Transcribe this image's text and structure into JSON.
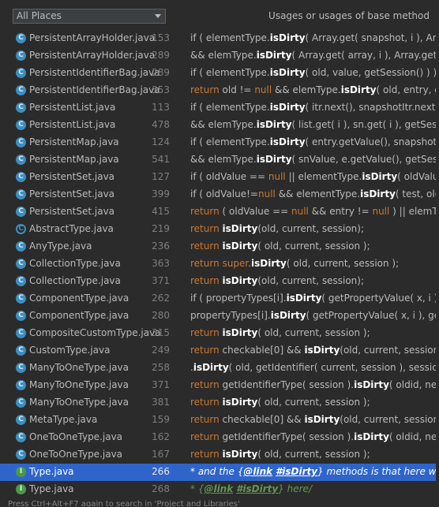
{
  "toolbar": {
    "scope_label": "All Places",
    "title": "Usages or usages of base method"
  },
  "usages": [
    {
      "icon": "class",
      "file": "PersistentArrayHolder.java",
      "line": "153",
      "code": [
        [
          "p",
          "if ( elementType."
        ],
        [
          "h",
          "isDirty"
        ],
        [
          "p",
          "( Array.get( snapshot, i ), Array.get"
        ]
      ]
    },
    {
      "icon": "class",
      "file": "PersistentArrayHolder.java",
      "line": "289",
      "code": [
        [
          "p",
          "&& elemType."
        ],
        [
          "h",
          "isDirty"
        ],
        [
          "p",
          "( Array.get( array, i ), Array.get( sn, i"
        ]
      ]
    },
    {
      "icon": "class",
      "file": "PersistentIdentifierBag.java",
      "line": "289",
      "code": [
        [
          "p",
          "if ( elementType."
        ],
        [
          "h",
          "isDirty"
        ],
        [
          "p",
          "( old, value, getSession() ) ) {"
        ]
      ]
    },
    {
      "icon": "class",
      "file": "PersistentIdentifierBag.java",
      "line": "353",
      "code": [
        [
          "k",
          "return"
        ],
        [
          "p",
          " old != "
        ],
        [
          "k",
          "null"
        ],
        [
          "p",
          " && elemType."
        ],
        [
          "h",
          "isDirty"
        ],
        [
          "p",
          "( old, entry, getSe"
        ]
      ]
    },
    {
      "icon": "class",
      "file": "PersistentList.java",
      "line": "113",
      "code": [
        [
          "p",
          "if ( elementType."
        ],
        [
          "h",
          "isDirty"
        ],
        [
          "p",
          "( itr.next(), snapshotItr.next(), getS"
        ]
      ]
    },
    {
      "icon": "class",
      "file": "PersistentList.java",
      "line": "478",
      "code": [
        [
          "p",
          "&& elemType."
        ],
        [
          "h",
          "isDirty"
        ],
        [
          "p",
          "( list.get( i ), sn.get( i ), getSession()"
        ]
      ]
    },
    {
      "icon": "class",
      "file": "PersistentMap.java",
      "line": "124",
      "code": [
        [
          "p",
          "if ( elementType."
        ],
        [
          "h",
          "isDirty"
        ],
        [
          "p",
          "( entry.getValue(), snapshotMap.g"
        ]
      ]
    },
    {
      "icon": "class",
      "file": "PersistentMap.java",
      "line": "541",
      "code": [
        [
          "p",
          "&& elemType."
        ],
        [
          "h",
          "isDirty"
        ],
        [
          "p",
          "( snValue, e.getValue(), getSession()"
        ]
      ]
    },
    {
      "icon": "class",
      "file": "PersistentSet.java",
      "line": "127",
      "code": [
        [
          "p",
          "if ( oldValue == "
        ],
        [
          "k",
          "null"
        ],
        [
          "p",
          " || elementType."
        ],
        [
          "h",
          "isDirty"
        ],
        [
          "p",
          "( oldValue, tes"
        ]
      ]
    },
    {
      "icon": "class",
      "file": "PersistentSet.java",
      "line": "399",
      "code": [
        [
          "p",
          "if ( oldValue!="
        ],
        [
          "k",
          "null"
        ],
        [
          "p",
          " && elementType."
        ],
        [
          "h",
          "isDirty"
        ],
        [
          "p",
          "( test, oldValu"
        ]
      ]
    },
    {
      "icon": "class",
      "file": "PersistentSet.java",
      "line": "415",
      "code": [
        [
          "k",
          "return"
        ],
        [
          "p",
          " ( oldValue == "
        ],
        [
          "k",
          "null"
        ],
        [
          "p",
          " && entry != "
        ],
        [
          "k",
          "null"
        ],
        [
          "p",
          " ) || elemType.i"
        ]
      ]
    },
    {
      "icon": "abstract",
      "file": "AbstractType.java",
      "line": "219",
      "code": [
        [
          "k",
          "return"
        ],
        [
          "p",
          " "
        ],
        [
          "h",
          "isDirty"
        ],
        [
          "p",
          "(old, current, session);"
        ]
      ]
    },
    {
      "icon": "class",
      "file": "AnyType.java",
      "line": "236",
      "code": [
        [
          "k",
          "return"
        ],
        [
          "p",
          " "
        ],
        [
          "h",
          "isDirty"
        ],
        [
          "p",
          "( old, current, session );"
        ]
      ]
    },
    {
      "icon": "class",
      "file": "CollectionType.java",
      "line": "363",
      "code": [
        [
          "k",
          "return super"
        ],
        [
          "p",
          "."
        ],
        [
          "h",
          "isDirty"
        ],
        [
          "p",
          "( old, current, session );"
        ]
      ]
    },
    {
      "icon": "class",
      "file": "CollectionType.java",
      "line": "371",
      "code": [
        [
          "k",
          "return"
        ],
        [
          "p",
          " "
        ],
        [
          "h",
          "isDirty"
        ],
        [
          "p",
          "(old, current, session);"
        ]
      ]
    },
    {
      "icon": "class",
      "file": "ComponentType.java",
      "line": "262",
      "code": [
        [
          "p",
          "if ( propertyTypes[i]."
        ],
        [
          "h",
          "isDirty"
        ],
        [
          "p",
          "( getPropertyValue( x, i ), getPr"
        ]
      ]
    },
    {
      "icon": "class",
      "file": "ComponentType.java",
      "line": "280",
      "code": [
        [
          "p",
          "propertyTypes[i]."
        ],
        [
          "h",
          "isDirty"
        ],
        [
          "p",
          "( getPropertyValue( x, i ), getPrope"
        ]
      ]
    },
    {
      "icon": "class",
      "file": "CompositeCustomType.java",
      "line": "315",
      "code": [
        [
          "k",
          "return"
        ],
        [
          "p",
          " "
        ],
        [
          "h",
          "isDirty"
        ],
        [
          "p",
          "( old, current, session );"
        ]
      ]
    },
    {
      "icon": "class",
      "file": "CustomType.java",
      "line": "249",
      "code": [
        [
          "k",
          "return"
        ],
        [
          "p",
          " checkable[0] && "
        ],
        [
          "h",
          "isDirty"
        ],
        [
          "p",
          "(old, current, session);"
        ]
      ]
    },
    {
      "icon": "class",
      "file": "ManyToOneType.java",
      "line": "258",
      "code": [
        [
          "p",
          "."
        ],
        [
          "h",
          "isDirty"
        ],
        [
          "p",
          "( old, getIdentifier( current, session ), session );"
        ]
      ]
    },
    {
      "icon": "class",
      "file": "ManyToOneType.java",
      "line": "371",
      "code": [
        [
          "k",
          "return"
        ],
        [
          "p",
          " getIdentifierType( session )."
        ],
        [
          "h",
          "isDirty"
        ],
        [
          "p",
          "( oldid, newid, se"
        ]
      ]
    },
    {
      "icon": "class",
      "file": "ManyToOneType.java",
      "line": "381",
      "code": [
        [
          "k",
          "return"
        ],
        [
          "p",
          " "
        ],
        [
          "h",
          "isDirty"
        ],
        [
          "p",
          "( old, current, session );"
        ]
      ]
    },
    {
      "icon": "class",
      "file": "MetaType.java",
      "line": "159",
      "code": [
        [
          "k",
          "return"
        ],
        [
          "p",
          " checkable[0] && "
        ],
        [
          "h",
          "isDirty"
        ],
        [
          "p",
          "(old, current, session);"
        ]
      ]
    },
    {
      "icon": "class",
      "file": "OneToOneType.java",
      "line": "162",
      "code": [
        [
          "k",
          "return"
        ],
        [
          "p",
          " getIdentifierType( session )."
        ],
        [
          "h",
          "isDirty"
        ],
        [
          "p",
          "( oldid, newid, se"
        ]
      ]
    },
    {
      "icon": "class",
      "file": "OneToOneType.java",
      "line": "167",
      "code": [
        [
          "k",
          "return"
        ],
        [
          "p",
          " "
        ],
        [
          "h",
          "isDirty"
        ],
        [
          "p",
          "( old, current, session );"
        ]
      ]
    },
    {
      "icon": "interface",
      "file": "Type.java",
      "line": "266",
      "selected": true,
      "code": [
        [
          "d",
          "* and the {"
        ],
        [
          "t",
          "@link"
        ],
        [
          "d",
          " "
        ],
        [
          "t",
          "#isDirty"
        ],
        [
          "d",
          "} methods is that here we need"
        ]
      ]
    },
    {
      "icon": "interface",
      "file": "Type.java",
      "line": "268",
      "code": [
        [
          "d",
          "* {"
        ],
        [
          "t",
          "@link"
        ],
        [
          "d",
          " "
        ],
        [
          "t",
          "#isDirty"
        ],
        [
          "d",
          "} here/"
        ]
      ]
    }
  ],
  "footer": {
    "hint": "Press Ctrl+Alt+F7 again to search in 'Project and Libraries'"
  }
}
